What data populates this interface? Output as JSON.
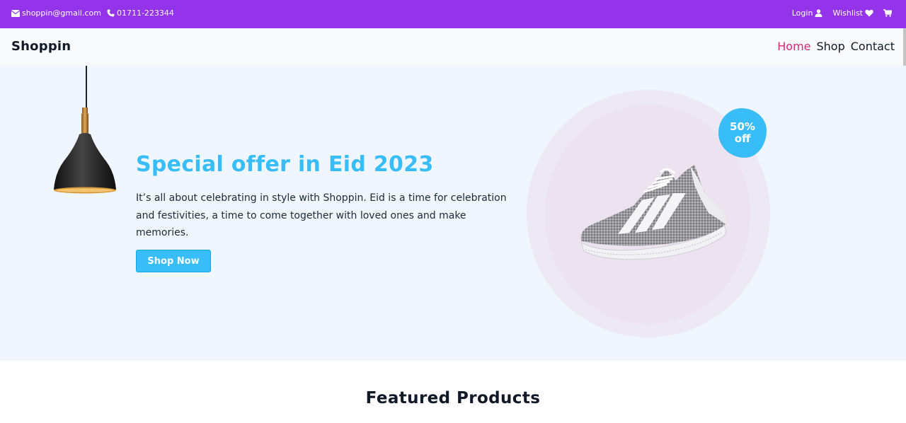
{
  "topbar": {
    "email": "shoppin@gmail.com",
    "phone": "01711-223344",
    "login": "Login",
    "wishlist": "Wishlist",
    "bg_color": "#9333ea"
  },
  "nav": {
    "brand": "Shoppin",
    "links": {
      "home": "Home",
      "shop": "Shop",
      "contact": "Contact"
    },
    "active_color": "#db2777"
  },
  "hero": {
    "title": "Special offer in Eid 2023",
    "description": "It’s all about celebrating in style with Shoppin. Eid is a time for celebration and festivities, a time to come together with loved ones and make memories.",
    "button": "Shop Now",
    "badge": {
      "line1": "50%",
      "line2": "off"
    },
    "accent_color": "#38bdf8"
  },
  "featured": {
    "title": "Featured Products"
  },
  "icons": {
    "email": "envelope-icon",
    "phone": "phone-icon",
    "login": "user-icon",
    "wishlist": "heart-icon",
    "cart": "cart-icon"
  }
}
